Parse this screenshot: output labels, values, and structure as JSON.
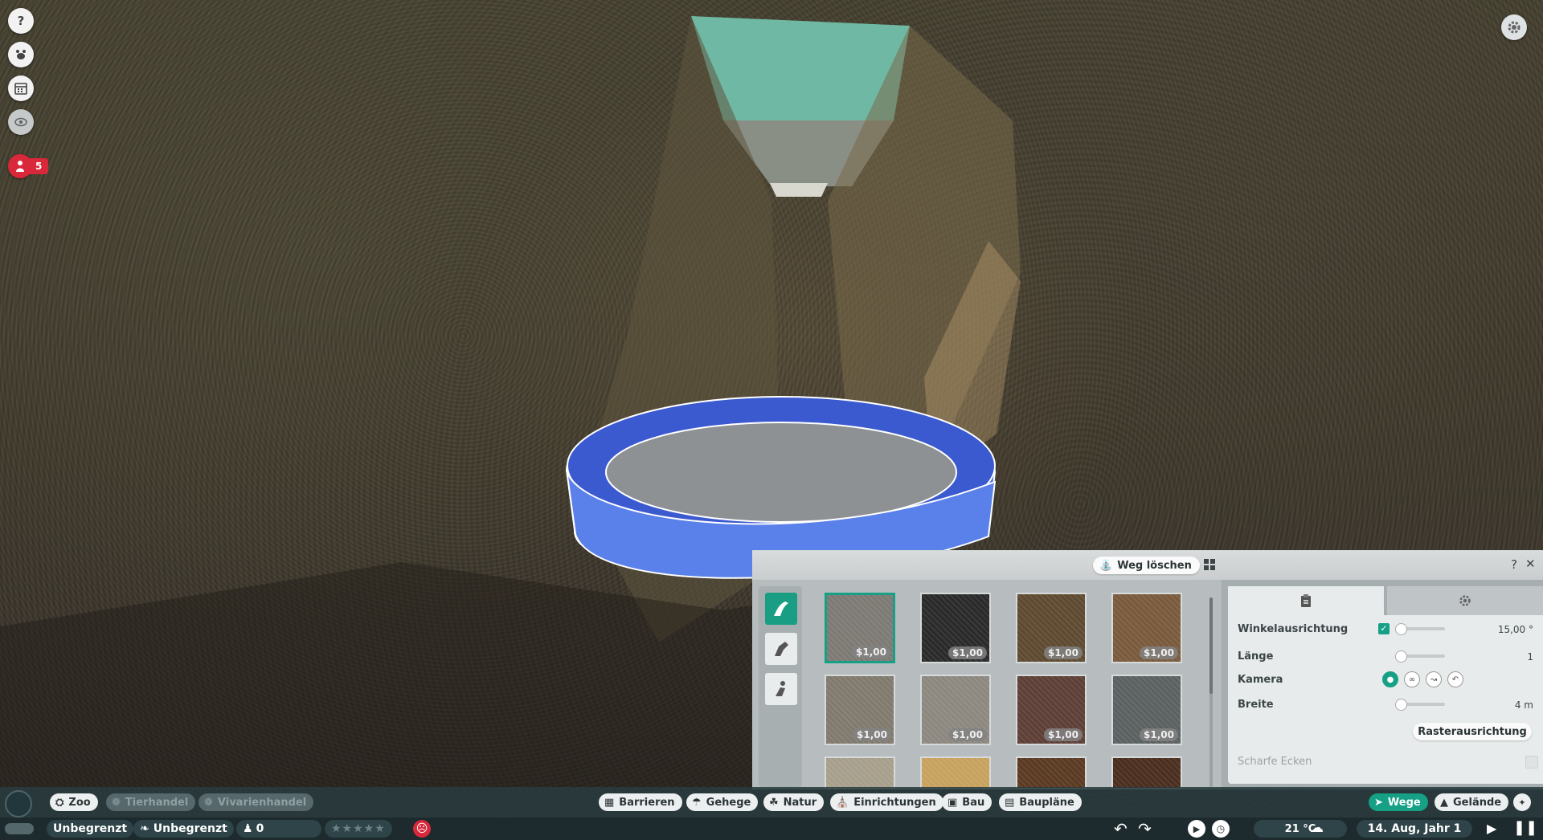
{
  "hud": {
    "left_icons": [
      "help-icon",
      "animal-icon",
      "calendar-icon",
      "eye-icon"
    ],
    "alert_count": "5",
    "settings_icon": "gear-icon"
  },
  "build_panel": {
    "delete_path_label": "Weg löschen",
    "help_label": "?",
    "close_label": "✕",
    "categories": [
      "path-tool-icon",
      "animal-path-icon",
      "staff-path-icon"
    ],
    "textures": [
      {
        "price": "$1,00",
        "color": "#7d7a74",
        "selected": true
      },
      {
        "price": "$1,00",
        "color": "#2a2a2a",
        "selected": false
      },
      {
        "price": "$1,00",
        "color": "#5e4a30",
        "selected": false
      },
      {
        "price": "$1,00",
        "color": "#7a5a3c",
        "selected": false
      },
      {
        "price": "$1,00",
        "color": "#807a6e",
        "selected": false
      },
      {
        "price": "$1,00",
        "color": "#8c8880",
        "selected": false
      },
      {
        "price": "$1,00",
        "color": "#5d3f36",
        "selected": false
      },
      {
        "price": "$1,00",
        "color": "#5a6160",
        "selected": false
      },
      {
        "price": "",
        "color": "#a79f8c",
        "selected": false
      },
      {
        "price": "",
        "color": "#c7a25e",
        "selected": false
      },
      {
        "price": "",
        "color": "#5a3a22",
        "selected": false
      },
      {
        "price": "",
        "color": "#4a2e1e",
        "selected": false
      }
    ],
    "settings": {
      "angle_label": "Winkelausrichtung",
      "angle_value": "15,00 °",
      "angle_checked": true,
      "length_label": "Länge",
      "length_value": "1",
      "camera_label": "Kamera",
      "width_label": "Breite",
      "width_value": "4 m",
      "grid_button": "Rasterausrichtung",
      "sharp_corners_label": "Scharfe Ecken"
    }
  },
  "toolbar": {
    "left_tabs": [
      {
        "label": "Zoo",
        "icon": "zoo-icon",
        "enabled": true
      },
      {
        "label": "Tierhandel",
        "icon": "paw-icon",
        "enabled": false
      },
      {
        "label": "Vivarienhandel",
        "icon": "vivarium-icon",
        "enabled": false
      }
    ],
    "center_tabs": [
      {
        "label": "Barrieren",
        "icon": "barrier-icon"
      },
      {
        "label": "Gehege",
        "icon": "habitat-icon"
      },
      {
        "label": "Natur",
        "icon": "nature-icon"
      },
      {
        "label": "Einrichtungen",
        "icon": "facility-icon"
      },
      {
        "label": "Bau",
        "icon": "build-icon"
      },
      {
        "label": "Baupläne",
        "icon": "blueprint-icon"
      }
    ],
    "right_tabs": [
      {
        "label": "Wege",
        "icon": "path-icon",
        "active": true
      },
      {
        "label": "Gelände",
        "icon": "terrain-icon",
        "active": false
      }
    ]
  },
  "status": {
    "money": "Unbegrenzt",
    "conservation": "Unbegrenzt",
    "guests": "0",
    "rating_stars": 5,
    "temperature": "21 °C",
    "date": "14. Aug, Jahr 1"
  },
  "colors": {
    "accent": "#16a085",
    "alert": "#d8283a",
    "ring": "#4a6fe0"
  }
}
